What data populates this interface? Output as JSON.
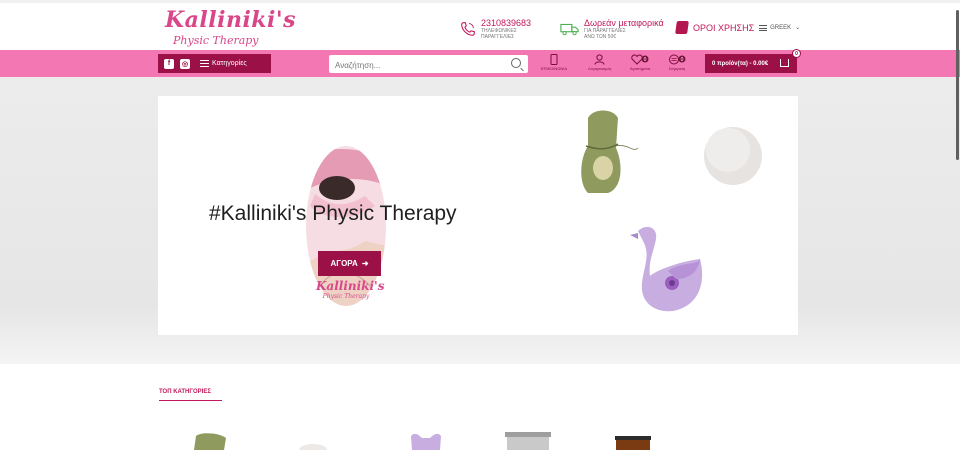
{
  "header": {
    "logo_line1": "Kalliniki's",
    "logo_line2": "Physic Therapy",
    "phone_number": "2310839683",
    "phone_sub": "ΤΗΛΕΦΩΝΙΚΕΣ ΠΑΡΑΓΓΕΛΙΕΣ",
    "shipping_title": "Δωρεάν μεταφορικά",
    "shipping_sub": "ΓΙΑ ΠΑΡΑΓΓΕΛΙΕΣ ΑΝΩ ΤΩΝ 50€",
    "terms_label": "ΟΡΟΙ ΧΡΗΣΗΣ",
    "language": "GREEK"
  },
  "navbar": {
    "categories_label": "Κατηγορίες",
    "search_placeholder": "Αναζήτηση...",
    "contact_label": "ΕΠΙΚΟΙΝΩΝΙΑ",
    "account_label": "Λογαριασμός",
    "wishlist_label": "Αγαπημένα",
    "wishlist_count": "0",
    "compare_label": "Σύγκριση",
    "compare_count": "0",
    "cart_label": "0 προϊόν(τα) - 0.00€",
    "cart_count": "0"
  },
  "hero": {
    "title": "#Kalliniki's Physic Therapy",
    "button_label": "ΑΓΟΡΑ",
    "brand_line1": "Kalliniki's",
    "brand_line2": "Physic Therapy"
  },
  "section": {
    "top_categories": "ΤΟΠ ΚΑΤΗΓΟΡΙΕΣ"
  },
  "colors": {
    "accent": "#9c1048",
    "navbar": "#f277b3",
    "brand_pink": "#d9468a"
  }
}
